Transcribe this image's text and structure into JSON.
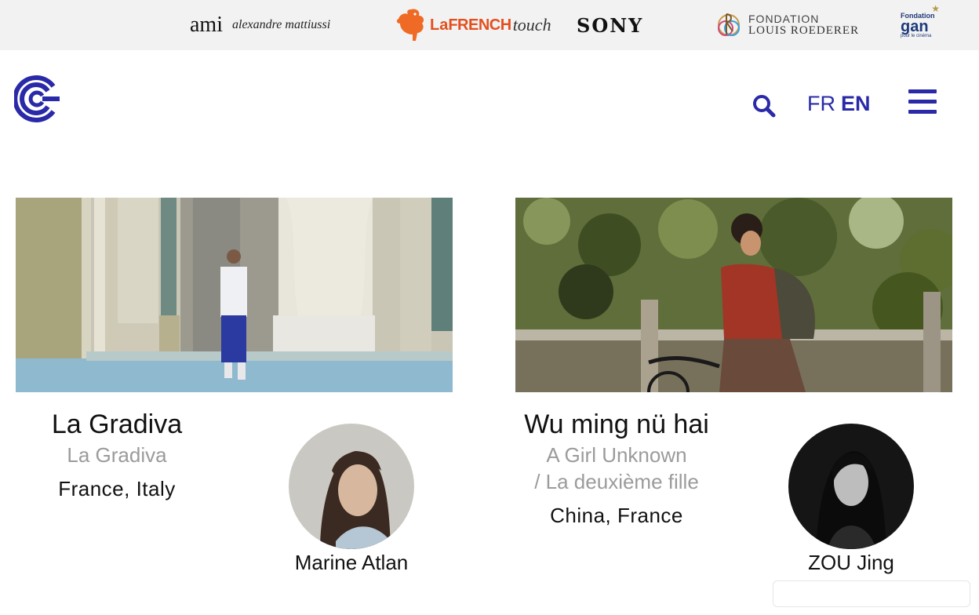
{
  "sponsors": {
    "ami_mark": "ami",
    "ami_name": "alexandre mattiussi",
    "french_la": "La",
    "french_word": "FRENCH",
    "french_touch": "touch",
    "sony": "SONY",
    "roederer_line1": "FONDATION",
    "roederer_line2": "LOUIS ROEDERER",
    "gan_line1": "Fondation",
    "gan_line2": "gan",
    "gan_line3": "pour le cinéma"
  },
  "header": {
    "lang_fr": "FR",
    "lang_en": "EN"
  },
  "colors": {
    "accent": "#2a2aa8",
    "subtitle": "#9b9b9b",
    "sponsor_bar": "#f2f2f2"
  },
  "films": [
    {
      "title": "La Gradiva",
      "subtitle_lines": [
        "La Gradiva"
      ],
      "country": "France, Italy",
      "director": "Marine Atlan"
    },
    {
      "title": "Wu ming nü hai",
      "subtitle_lines": [
        "A Girl Unknown",
        "/ La deuxième fille"
      ],
      "country": "China, France",
      "director": "ZOU Jing"
    }
  ],
  "icons": {
    "logo": "festival-logo-icon",
    "search": "search-icon",
    "menu": "hamburger-menu-icon"
  }
}
